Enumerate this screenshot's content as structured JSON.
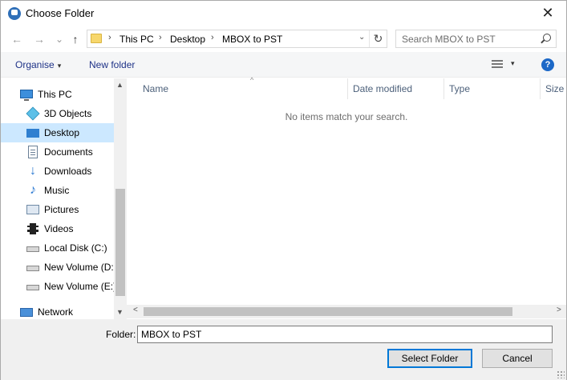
{
  "window": {
    "title": "Choose Folder",
    "close_glyph": "✕"
  },
  "nav": {
    "back_glyph": "←",
    "forward_glyph": "→",
    "recent_glyph": "⌄",
    "up_glyph": "↑",
    "breadcrumbs": [
      "This PC",
      "Desktop",
      "MBOX to PST"
    ],
    "separator_glyph": "›",
    "dropdown_glyph": "⌄",
    "refresh_glyph": "↻",
    "search_placeholder": "Search MBOX to PST"
  },
  "toolbar": {
    "organise_label": "Organise",
    "new_folder_label": "New folder",
    "caret_glyph": "▾",
    "help_glyph": "?"
  },
  "sidebar": {
    "items": [
      {
        "label": "This PC",
        "icon": "computer-icon"
      },
      {
        "label": "3D Objects",
        "icon": "cube-icon"
      },
      {
        "label": "Desktop",
        "icon": "desktop-icon",
        "selected": true
      },
      {
        "label": "Documents",
        "icon": "documents-icon"
      },
      {
        "label": "Downloads",
        "icon": "download-arrow-icon"
      },
      {
        "label": "Music",
        "icon": "music-note-icon"
      },
      {
        "label": "Pictures",
        "icon": "pictures-icon"
      },
      {
        "label": "Videos",
        "icon": "film-icon"
      },
      {
        "label": "Local Disk (C:)",
        "icon": "drive-icon"
      },
      {
        "label": "New Volume (D:",
        "icon": "drive-icon"
      },
      {
        "label": "New Volume (E:)",
        "icon": "drive-icon"
      },
      {
        "label": "Network",
        "icon": "network-icon"
      }
    ],
    "scroll_up_glyph": "▲",
    "scroll_down_glyph": "▼"
  },
  "content": {
    "columns": [
      "Name",
      "Date modified",
      "Type",
      "Size"
    ],
    "sort_glyph": "^",
    "empty_message": "No items match your search.",
    "scroll_left_glyph": "<",
    "scroll_right_glyph": ">"
  },
  "footer": {
    "folder_label": "Folder:",
    "folder_value": "MBOX to PST",
    "select_button": "Select Folder",
    "cancel_button": "Cancel"
  },
  "colors": {
    "accent": "#0078d7",
    "selection": "#cce8ff",
    "link": "#1e3287"
  }
}
